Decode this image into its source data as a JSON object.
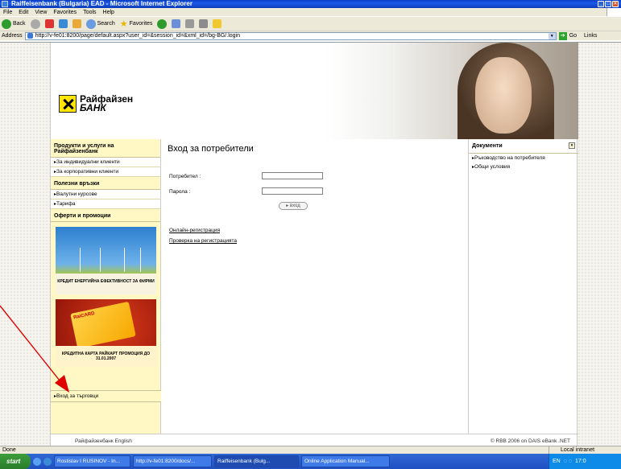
{
  "window": {
    "title": "Raiffeisenbank (Bulgaria) EAD - Microsoft Internet Explorer"
  },
  "menu": [
    "File",
    "Edit",
    "View",
    "Favorites",
    "Tools",
    "Help"
  ],
  "toolbar": {
    "back": "Back",
    "search": "Search",
    "favorites": "Favorites"
  },
  "address": {
    "label": "Address",
    "url": "http://v-fe01:8200/page/default.aspx?user_id=&session_id=&xml_id=/bg-BG/.login",
    "go": "Go",
    "links": "Links"
  },
  "logo": {
    "line1": "Райфайзен",
    "line2": "БАНК"
  },
  "left": {
    "section1": "Продукти и услуги на Райфайзенбанк",
    "items1": [
      "За индивидуални клиенти",
      "За корпоративни клиенти"
    ],
    "section2": "Полезни връзки",
    "items2": [
      "Валутни курсове",
      "Тарифа"
    ],
    "section3": "Оферти и промоции",
    "promo1_caption": "КРЕДИТ ЕНЕРГИЙНА ЕФЕКТИВНОСТ ЗА ФИРМИ",
    "promo2_card": "RaiCARD",
    "promo2_caption": "КРЕДИТНА КАРТА РАЙКАРТ ПРОМОЦИЯ ДО 31.01.2007",
    "trader_link": "Вход за търговци"
  },
  "login": {
    "title": "Вход за потребители",
    "user_label": "Потребител :",
    "pass_label": "Парола :",
    "button": "вход",
    "register_link": "Онлайн-регистрация",
    "check_link": "Проверка на регистрацията"
  },
  "right": {
    "title": "Документи",
    "items": [
      "Ръководство на потребителя",
      "Общи условия"
    ]
  },
  "footer": {
    "left": "Райфайзенбанк   English",
    "right": "© RBB 2006 on DAIS eBank .NET"
  },
  "status": {
    "left": "Done",
    "zone": "Local intranet"
  },
  "taskbar": {
    "start": "start",
    "tasks": [
      "Rostislav I RUSINOV - In...",
      "http://v-fe01:8200/docs/...",
      "Raiffeisenbank (Bulg...",
      "Online Application Manual..."
    ],
    "lang": "EN",
    "clock": "17:0"
  },
  "colors": {
    "accent_yellow": "#fff7c4",
    "brand_yellow": "#ffe600",
    "arrow": "#e00000"
  }
}
